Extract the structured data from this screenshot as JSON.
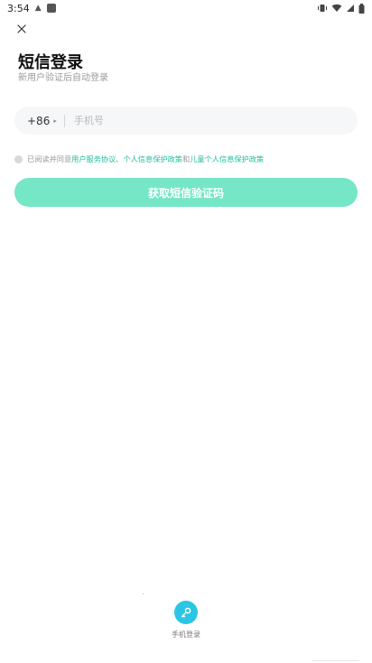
{
  "status_bar": {
    "time": "3:54",
    "icons": [
      "vibrate-icon",
      "wifi-icon",
      "signal-icon",
      "battery-icon"
    ]
  },
  "header": {
    "title": "短信登录",
    "subtitle": "新用户验证后自动登录"
  },
  "phone_input": {
    "country_code": "+86",
    "placeholder": "手机号",
    "value": ""
  },
  "agreement": {
    "prefix": "已阅读并同意",
    "link_user": "用户服务协议",
    "sep1": "、",
    "link_privacy": "个人信息保护政策",
    "sep2": "和",
    "link_child": "儿童个人信息保护政策"
  },
  "sms_button": {
    "label": "获取短信验证码"
  },
  "alt_login": {
    "label": "手机登录",
    "icon": "key-icon"
  },
  "colors": {
    "accent": "#1fbf9e",
    "button": "#75e6c6",
    "alt_icon_bg": "#2bc6e3"
  }
}
